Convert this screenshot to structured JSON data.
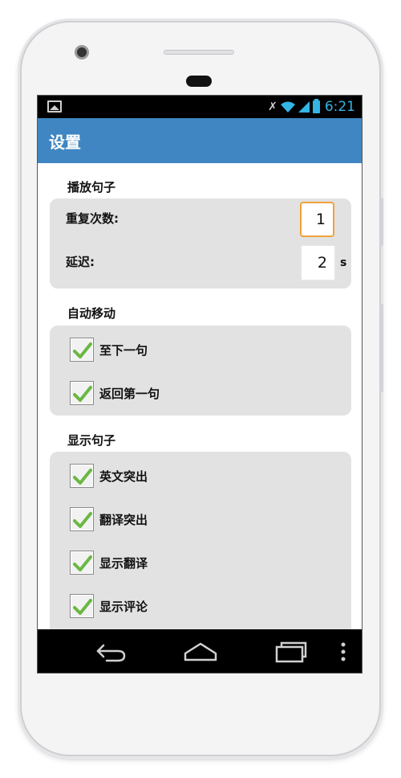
{
  "status_bar": {
    "time": "6:21",
    "icons": [
      "image-icon",
      "mute-icon",
      "wifi-icon",
      "signal-icon",
      "battery-icon"
    ]
  },
  "app_bar": {
    "title": "设置",
    "color": "#3f86c2"
  },
  "sections": {
    "play": {
      "title": "播放句子",
      "repeat_label": "重复次数:",
      "repeat_value": "1",
      "delay_label": "延迟:",
      "delay_value": "2",
      "delay_unit": "s"
    },
    "auto_move": {
      "title": "自动移动",
      "items": [
        {
          "label": "至下一句",
          "checked": true
        },
        {
          "label": "返回第一句",
          "checked": true
        }
      ]
    },
    "display": {
      "title": "显示句子",
      "items": [
        {
          "label": "英文突出",
          "checked": true
        },
        {
          "label": "翻译突出",
          "checked": true
        },
        {
          "label": "显示翻译",
          "checked": true
        },
        {
          "label": "显示评论",
          "checked": true
        }
      ]
    }
  },
  "nav_bar": {
    "icons": [
      "back-icon",
      "home-icon",
      "recents-icon",
      "overflow-menu-icon"
    ]
  },
  "colors": {
    "accent": "#3f86c2",
    "check": "#6ab843",
    "focus_border": "#f0a23c",
    "panel": "#e2e2e2"
  }
}
